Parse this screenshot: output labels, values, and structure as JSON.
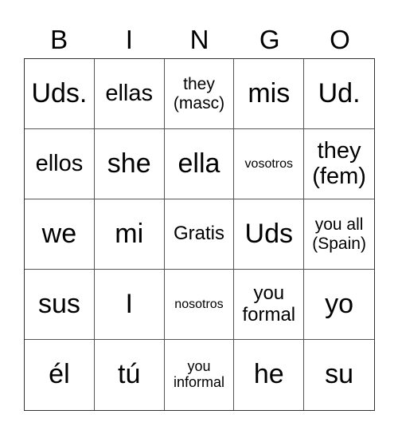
{
  "header": {
    "letters": [
      "B",
      "I",
      "N",
      "G",
      "O"
    ]
  },
  "board": {
    "cells": [
      "Uds.",
      "ellas",
      "they (masc)",
      "mis",
      "Ud.",
      "ellos",
      "she",
      "ella",
      "vosotros",
      "they (fem)",
      "we",
      "mi",
      "Gratis",
      "Uds",
      "you all (Spain)",
      "sus",
      "I",
      "nosotros",
      "you formal",
      "yo",
      "él",
      "tú",
      "you informal",
      "he",
      "su"
    ],
    "free_space": "Gratis"
  }
}
